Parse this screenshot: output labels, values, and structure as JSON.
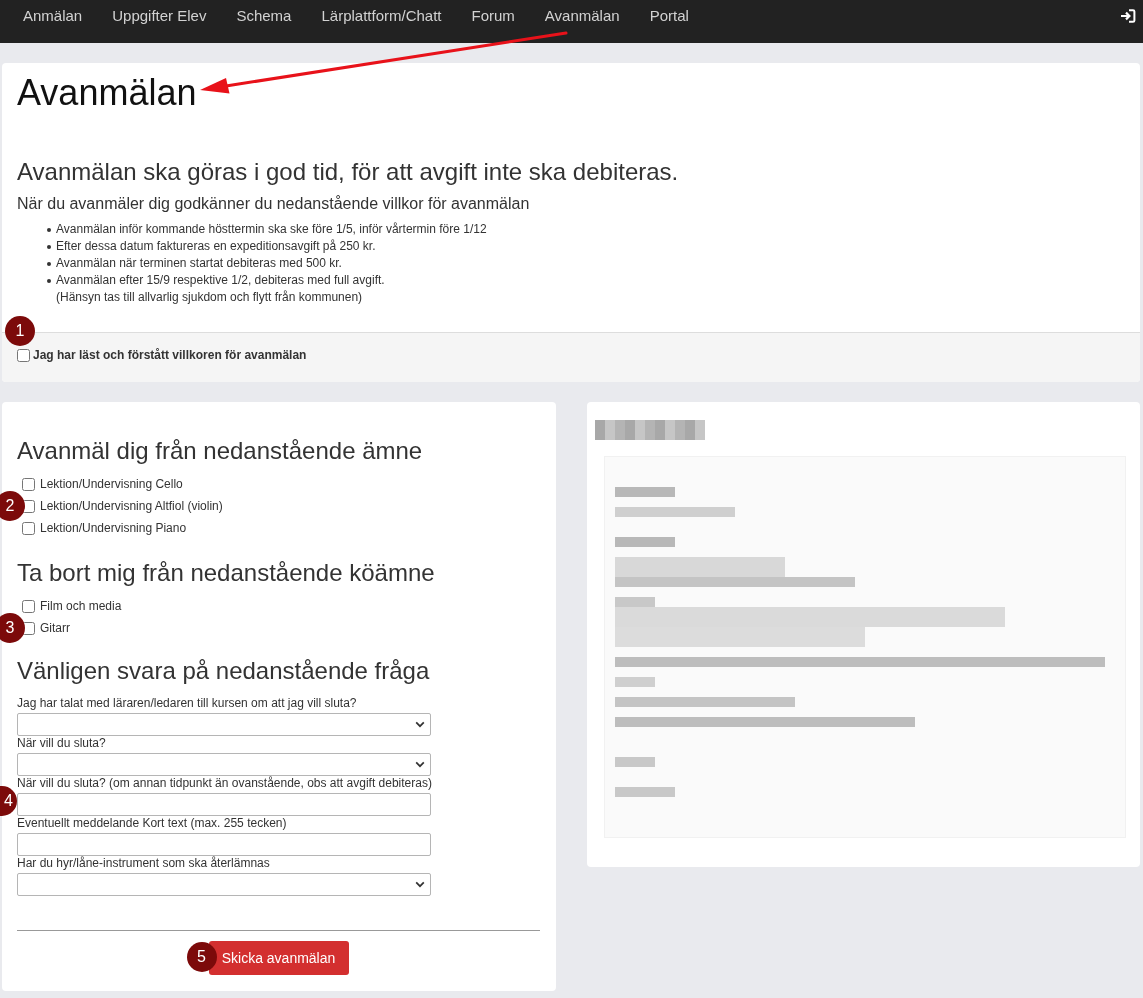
{
  "nav": {
    "items": [
      "Anmälan",
      "Uppgifter Elev",
      "Schema",
      "Lärplattform/Chatt",
      "Forum",
      "Avanmälan",
      "Portal"
    ]
  },
  "terms": {
    "title": "Avanmälan",
    "subtitle": "Avanmälan ska göras i god tid, för att avgift inte ska debiteras.",
    "intro": "När du avanmäler dig godkänner du nedanstående villkor för avanmälan",
    "items": [
      "Avanmälan inför kommande hösttermin ska ske före 1/5, inför vårtermin före 1/12",
      "Efter dessa datum faktureras en expeditionsavgift på 250 kr.",
      "Avanmälan när terminen startat debiteras med 500 kr.",
      "Avanmälan efter 15/9 respektive 1/2, debiteras med full avgift.\n(Hänsyn tas till allvarlig sjukdom och flytt från kommunen)"
    ],
    "accept": {
      "label": "Jag har läst och förstått villkoren för avanmälan",
      "checked": false,
      "marker": "1"
    }
  },
  "form": {
    "groups": [
      {
        "heading": "Avanmäl dig från nedanstående ämne",
        "options": [
          {
            "label": "Lektion/Undervisning Cello",
            "checked": false
          },
          {
            "label": "Lektion/Undervisning Altfiol (violin)",
            "checked": false,
            "marker": "2"
          },
          {
            "label": "Lektion/Undervisning Piano",
            "checked": false
          }
        ]
      },
      {
        "heading": "Ta bort mig från nedanstående köämne",
        "options": [
          {
            "label": "Film och media",
            "checked": false
          },
          {
            "label": "Gitarr",
            "checked": false,
            "marker": "3"
          }
        ]
      }
    ],
    "questions_heading": "Vänligen svara på nedanstående fråga",
    "questions": [
      {
        "label": "Jag har talat med läraren/ledaren till kursen om att jag vill sluta?",
        "kind": "select"
      },
      {
        "label": "När vill du sluta?",
        "kind": "select"
      },
      {
        "label": "När vill du sluta? (om annan tidpunkt än ovanstående, obs att avgift debiteras)",
        "kind": "text",
        "marker": "4"
      },
      {
        "label": "Eventuellt meddelande Kort text (max. 255 tecken)",
        "kind": "text"
      },
      {
        "label": "Har du hyr/låne-instrument som ska återlämnas",
        "kind": "select"
      }
    ],
    "submit": {
      "label": "Skicka avanmälan",
      "marker": "5"
    }
  }
}
